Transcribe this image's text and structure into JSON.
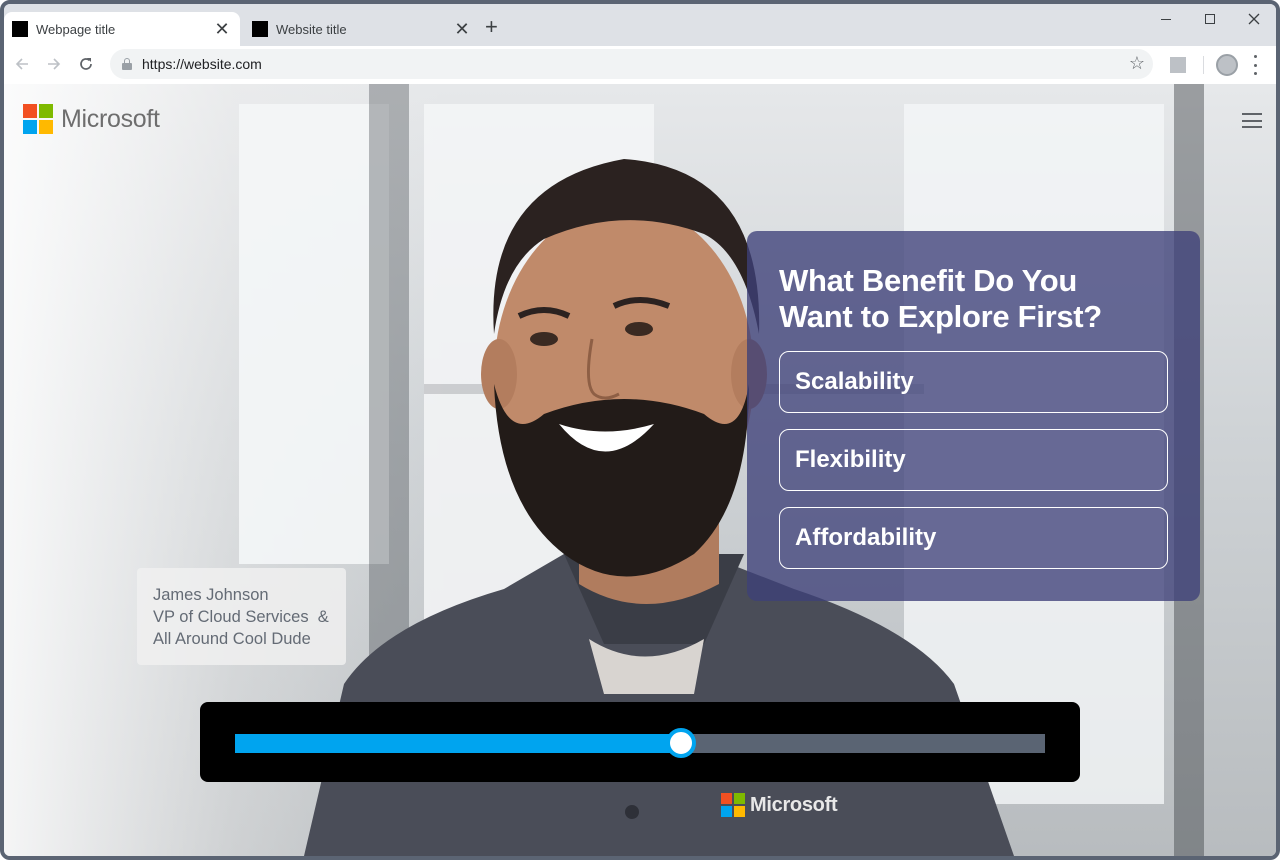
{
  "browser": {
    "tabs": [
      {
        "title": "Webpage title",
        "active": true
      },
      {
        "title": "Website title",
        "active": false
      }
    ],
    "new_tab_symbol": "+",
    "close_symbol": "✕",
    "url": "https://website.com",
    "star_symbol": "☆"
  },
  "brand": {
    "wordmark": "Microsoft",
    "colors": {
      "red": "#f25022",
      "green": "#7fba00",
      "blue": "#00a4ef",
      "yellow": "#ffb900"
    }
  },
  "question": {
    "title_line1": "What Benefit Do You",
    "title_line2": "Want to Explore First?",
    "options": [
      "Scalability",
      "Flexibility",
      "Affordability"
    ]
  },
  "speaker": {
    "name": "James Johnson",
    "title_line1": "VP of Cloud Services  &",
    "title_line2": "All Around Cool Dude"
  },
  "playback": {
    "progress": 0.55,
    "accent_color": "#00a4ef"
  },
  "shirt_logo": {
    "wordmark": "Microsoft"
  }
}
